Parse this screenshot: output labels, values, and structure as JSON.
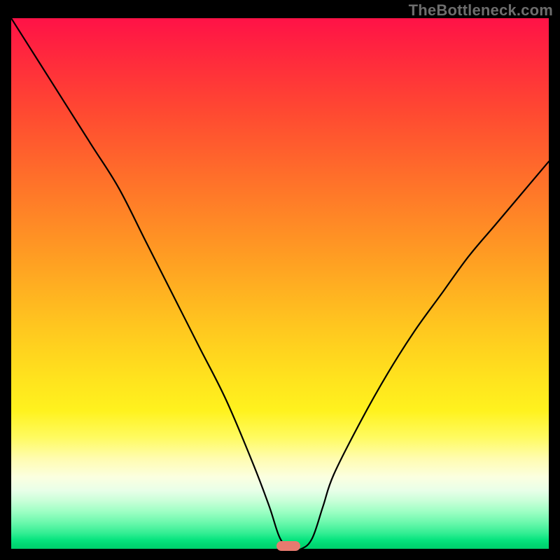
{
  "watermark": "TheBottleneck.com",
  "chart_data": {
    "type": "line",
    "title": "",
    "xlabel": "",
    "ylabel": "",
    "xlim": [
      0,
      100
    ],
    "ylim": [
      0,
      100
    ],
    "background_gradient": {
      "top": "#ff1247",
      "middle": "#ffe31e",
      "bottom": "#00cf6d",
      "note": "vertical gradient red → orange → yellow → pale → green"
    },
    "series": [
      {
        "name": "bottleneck-curve",
        "x": [
          0,
          5,
          10,
          15,
          20,
          25,
          30,
          35,
          40,
          45,
          48,
          50,
          52,
          54,
          56,
          58,
          60,
          65,
          70,
          75,
          80,
          85,
          90,
          95,
          100
        ],
        "values": [
          100,
          92,
          84,
          76,
          68,
          58,
          48,
          38,
          28,
          16,
          8,
          2,
          0,
          0,
          2,
          8,
          14,
          24,
          33,
          41,
          48,
          55,
          61,
          67,
          73
        ],
        "note": "approximate percentage height along y for V-shaped curve; minimum ≈ x 52-54"
      }
    ],
    "marker": {
      "x": 51.5,
      "y": 0.5,
      "color": "#e77a6f",
      "shape": "pill"
    },
    "grid": false,
    "legend": false
  }
}
